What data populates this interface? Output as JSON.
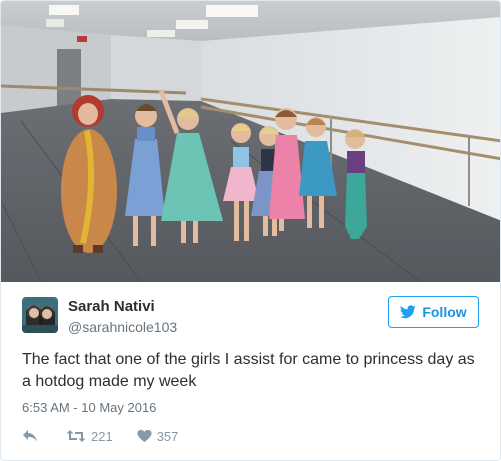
{
  "tweet": {
    "display_name": "Sarah Nativi",
    "handle": "@sarahnicole103",
    "follow_label": "Follow",
    "text": "The fact that one of the girls I assist for came to princess day as a hotdog made my week",
    "timestamp": "6:53 AM - 10 May 2016",
    "retweet_count": "221",
    "like_count": "357"
  },
  "icons": {
    "follow": "twitter-bird-icon",
    "reply": "reply-arrow-icon",
    "retweet": "retweet-icon",
    "like": "heart-icon"
  },
  "colors": {
    "accent": "#1da1f2",
    "text": "#292f33",
    "muted": "#66757f",
    "action": "#8899a6"
  }
}
